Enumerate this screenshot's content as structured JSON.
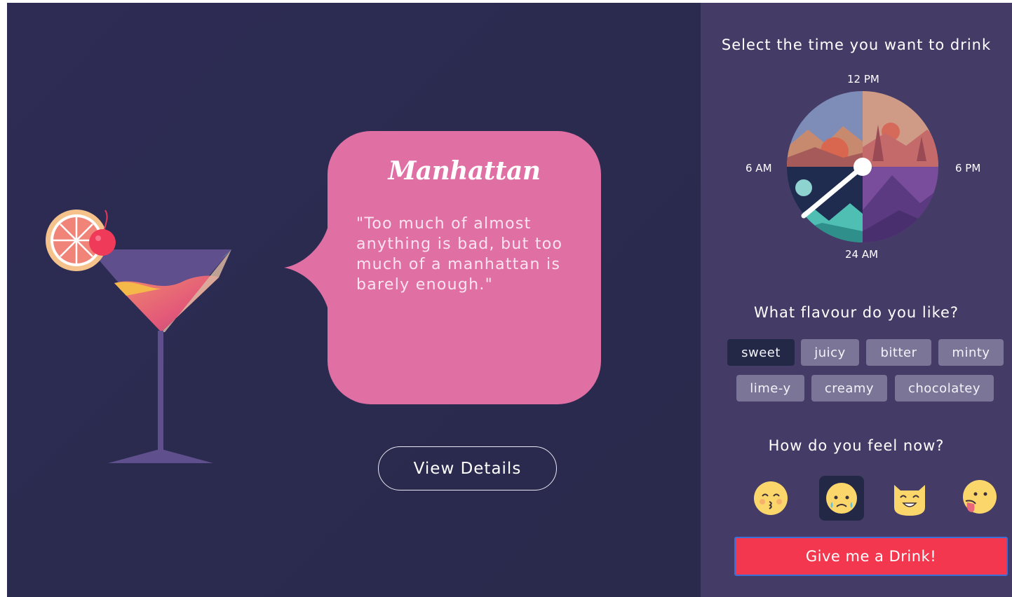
{
  "drink": {
    "name": "Manhattan",
    "quote": "\"Too much of almost anything is bad, but too much of a manhattan is barely enough.\"",
    "view_details_label": "View Details"
  },
  "time_picker": {
    "title": "Select the time you want to drink",
    "labels": {
      "top": "12 PM",
      "left": "6 AM",
      "right": "6 PM",
      "bottom": "24 AM"
    }
  },
  "flavour": {
    "title": "What flavour do you like?",
    "options": [
      "sweet",
      "juicy",
      "bitter",
      "minty",
      "lime-y",
      "creamy",
      "chocolatey"
    ],
    "selected": "sweet"
  },
  "mood": {
    "title": "How do you feel now?",
    "options": [
      "kissing-face-icon",
      "sad-tear-face-icon",
      "happy-cat-face-icon",
      "tongue-out-face-icon"
    ],
    "selected": "sad-tear-face-icon"
  },
  "cta_label": "Give me a Drink!",
  "colors": {
    "background": "#2b2b50",
    "side_panel": "#443c67",
    "bubble": "#e06fa4",
    "chip": "#7b7597",
    "chip_active": "#242847",
    "cta": "#f3374f"
  }
}
